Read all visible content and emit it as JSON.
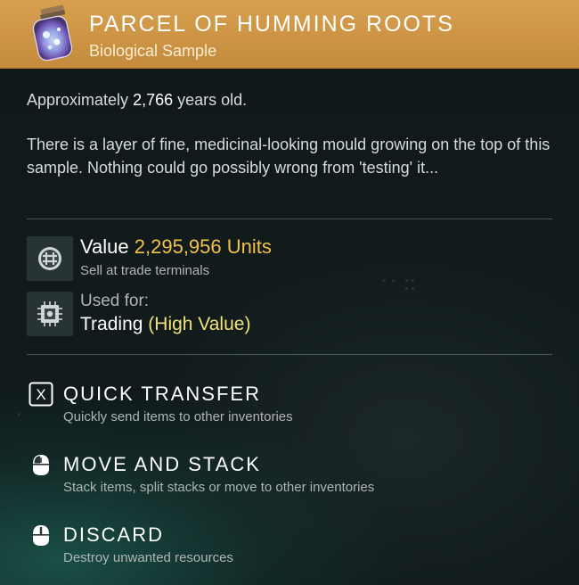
{
  "item": {
    "title": "PARCEL OF HUMMING ROOTS",
    "category": "Biological Sample",
    "icon": "sample-jar-icon",
    "header_color": "#cc9444"
  },
  "age": {
    "prefix": "Approximately",
    "years": "2,766",
    "suffix": "years old."
  },
  "description": "There is a layer of fine, medicinal-looking mould growing on the top of this sample. Nothing could go possibly wrong from 'testing' it...",
  "value": {
    "label": "Value",
    "amount": "2,295,956 Units",
    "sub": "Sell at trade terminals",
    "icon": "units-icon",
    "amount_color": "#f2c14a"
  },
  "usage": {
    "label": "Used for:",
    "value": "Trading",
    "tag": "(High Value)",
    "icon": "trade-chip-icon",
    "tag_color": "#f3e17a"
  },
  "actions": [
    {
      "key": "X",
      "title": "QUICK TRANSFER",
      "sub": "Quickly send items to other inventories",
      "icon": "x-key-icon"
    },
    {
      "title": "MOVE AND STACK",
      "sub": "Stack items, split stacks or move to other inventories",
      "icon": "mouse-left-click-icon"
    },
    {
      "title": "DISCARD",
      "sub": "Destroy unwanted resources",
      "icon": "mouse-hold-icon"
    }
  ]
}
